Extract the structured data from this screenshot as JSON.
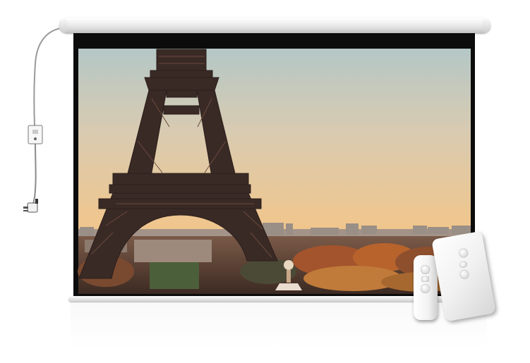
{
  "image": {
    "subject": "motorized-projector-screen",
    "projected_scene": "eiffel-tower-sunset",
    "accessories": [
      "power-cable",
      "control-box",
      "plug",
      "remote-control-large",
      "remote-control-small"
    ],
    "colors": {
      "sky_top": "#b4c7c6",
      "sky_mid": "#e6c9a1",
      "sky_bottom": "#f0c28a",
      "tower": "#3a2a26",
      "frame": "#0c0c0c",
      "housing": "#e8e8e8"
    }
  }
}
